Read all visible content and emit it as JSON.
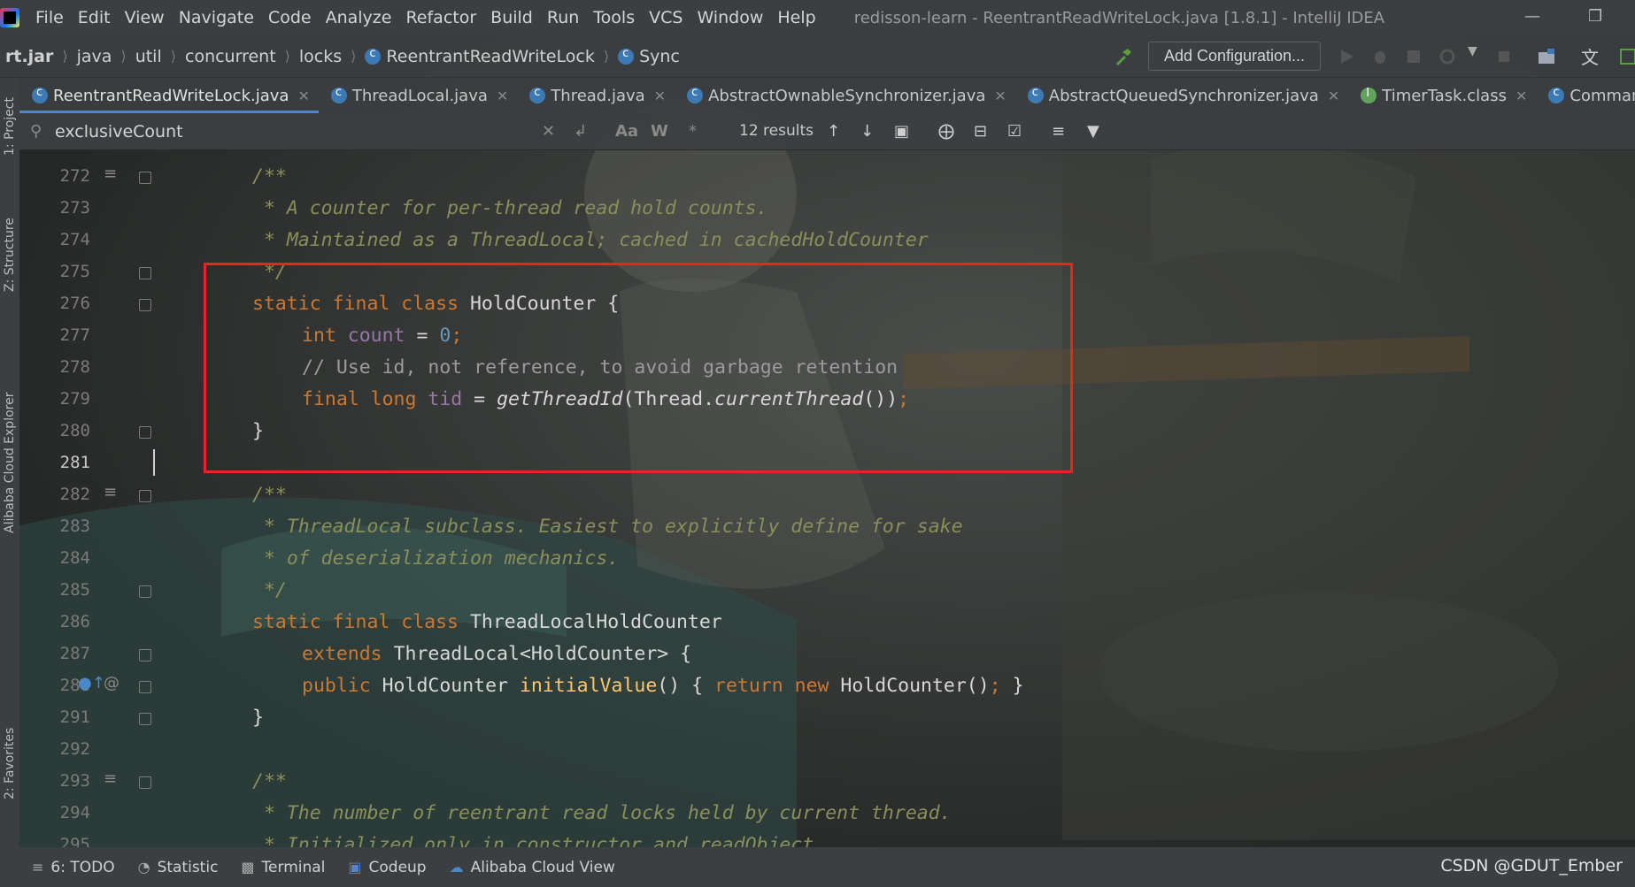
{
  "menu": {
    "items": [
      "File",
      "Edit",
      "View",
      "Navigate",
      "Code",
      "Analyze",
      "Refactor",
      "Build",
      "Run",
      "Tools",
      "VCS",
      "Window",
      "Help"
    ],
    "window_title": "redisson-learn - ReentrantReadWriteLock.java [1.8.1] - IntelliJ IDEA"
  },
  "breadcrumb": {
    "items": [
      "rt.jar",
      "java",
      "util",
      "concurrent",
      "locks",
      "ReentrantReadWriteLock",
      "Sync"
    ],
    "add_configuration": "Add Configuration..."
  },
  "tabs": [
    {
      "label": "ReentrantReadWriteLock.java",
      "active": true
    },
    {
      "label": "ThreadLocal.java",
      "active": false
    },
    {
      "label": "Thread.java",
      "active": false
    },
    {
      "label": "AbstractOwnableSynchronizer.java",
      "active": false
    },
    {
      "label": "AbstractQueuedSynchronizer.java",
      "active": false
    },
    {
      "label": "TimerTask.class",
      "active": false
    },
    {
      "label": "CommandB",
      "active": false
    }
  ],
  "search": {
    "value": "exclusiveCount",
    "results": "12 results",
    "match_case": "Aa",
    "words": "W",
    "regex": "*"
  },
  "side_panels": [
    "1: Project",
    "Z: Structure",
    "Alibaba Cloud Explorer",
    "2: Favorites"
  ],
  "editor": {
    "line_numbers": [
      "272",
      "273",
      "274",
      "275",
      "276",
      "277",
      "278",
      "279",
      "280",
      "281",
      "282",
      "283",
      "284",
      "285",
      "286",
      "287",
      "288",
      "291",
      "292",
      "293",
      "294",
      "295"
    ],
    "current_line": "281"
  },
  "bottom_tools": [
    "6: TODO",
    "Statistic",
    "Terminal",
    "Codeup",
    "Alibaba Cloud View"
  ],
  "watermark": "CSDN @GDUT_Ember",
  "colors": {
    "keyword": "#cc7832",
    "comment": "#8a8f5a",
    "number": "#6897bb",
    "field": "#9876aa",
    "method": "#ffc66d",
    "highlight_box": "#e8261f",
    "tab_underline": "#4a88c7"
  }
}
